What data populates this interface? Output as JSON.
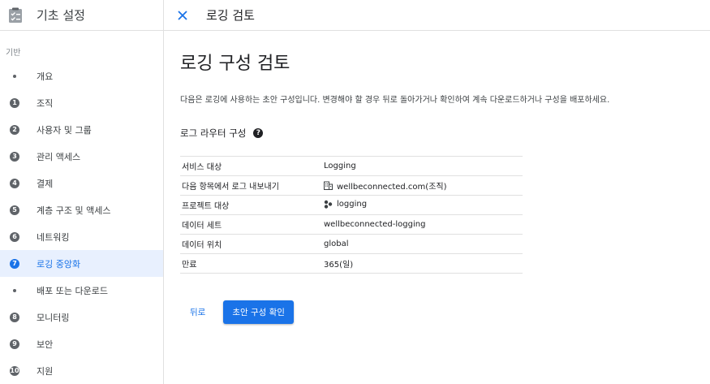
{
  "sidebar": {
    "title": "기초 설정",
    "section_label": "기반",
    "items": [
      {
        "marker": "",
        "label": "개요",
        "type": "dot"
      },
      {
        "marker": "1",
        "label": "조직",
        "type": "num"
      },
      {
        "marker": "2",
        "label": "사용자 및 그룹",
        "type": "num"
      },
      {
        "marker": "3",
        "label": "관리 액세스",
        "type": "num"
      },
      {
        "marker": "4",
        "label": "결제",
        "type": "num"
      },
      {
        "marker": "5",
        "label": "계층 구조 및 액세스",
        "type": "num"
      },
      {
        "marker": "6",
        "label": "네트워킹",
        "type": "num"
      },
      {
        "marker": "7",
        "label": "로깅 중앙화",
        "type": "num",
        "active": true
      },
      {
        "marker": "",
        "label": "배포 또는 다운로드",
        "type": "dot"
      },
      {
        "marker": "8",
        "label": "모니터링",
        "type": "num"
      },
      {
        "marker": "9",
        "label": "보안",
        "type": "num"
      },
      {
        "marker": "10",
        "label": "지원",
        "type": "num"
      }
    ]
  },
  "topbar": {
    "close_icon": "close-icon",
    "title": "로깅 검토"
  },
  "main": {
    "title": "로깅 구성 검토",
    "description": "다음은 로깅에 사용하는 초안 구성입니다. 변경해야 할 경우 뒤로 돌아가거나 확인하여 계속 다운로드하거나 구성을 배포하세요.",
    "section_title": "로그 라우터 구성",
    "help_icon": "?",
    "rows": [
      {
        "key": "서비스 대상",
        "value": "Logging",
        "icon": ""
      },
      {
        "key": "다음 항목에서 로그 내보내기",
        "value": "wellbeconnected.com(조직)",
        "icon": "organization-icon"
      },
      {
        "key": "프로젝트 대상",
        "value": "logging",
        "icon": "project-icon"
      },
      {
        "key": "데이터 세트",
        "value": "wellbeconnected-logging",
        "icon": ""
      },
      {
        "key": "데이터 위치",
        "value": "global",
        "icon": ""
      },
      {
        "key": "만료",
        "value": "365(일)",
        "icon": ""
      }
    ],
    "back_label": "뒤로",
    "confirm_label": "초안 구성 확인"
  },
  "colors": {
    "accent": "#1a73e8",
    "active_bg": "#e8f0fe",
    "marker": "#5f6368"
  }
}
